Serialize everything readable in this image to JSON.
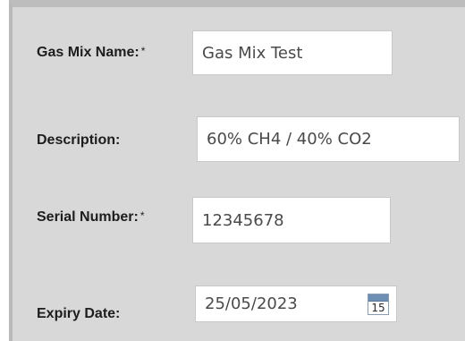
{
  "form": {
    "gas_mix_name": {
      "label": "Gas Mix Name:",
      "required_mark": "*",
      "value": "Gas Mix Test"
    },
    "description": {
      "label": "Description:",
      "value": "60% CH4 / 40% CO2"
    },
    "serial_number": {
      "label": "Serial Number:",
      "required_mark": "*",
      "value": "12345678"
    },
    "expiry_date": {
      "label": "Expiry Date:",
      "value": "25/05/2023",
      "calendar_icon_day": "15"
    }
  },
  "icons": {
    "calendar": "calendar-icon"
  }
}
